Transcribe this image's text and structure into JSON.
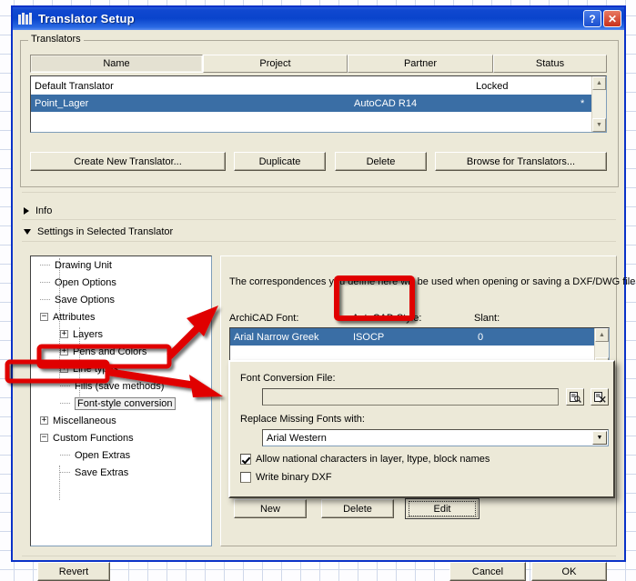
{
  "window": {
    "title": "Translator Setup",
    "icon": "archicad-bars-icon",
    "help_label": "?",
    "close_label": "✕"
  },
  "translators_group": {
    "label": "Translators",
    "columns": [
      "Name",
      "Project",
      "Partner",
      "Status"
    ],
    "rows": [
      {
        "name": "Default Translator",
        "project": "",
        "partner": "",
        "status": "Locked",
        "selected": false
      },
      {
        "name": "Point_Lager",
        "project": "AutoCAD R14",
        "partner": "",
        "status": "*",
        "selected": true
      }
    ],
    "buttons": [
      "Create New Translator...",
      "Duplicate",
      "Delete",
      "Browse for Translators..."
    ]
  },
  "sections": {
    "info": {
      "label": "Info",
      "expanded": false
    },
    "settings": {
      "label": "Settings in Selected Translator",
      "expanded": true
    }
  },
  "tree": {
    "items": [
      {
        "label": "Drawing Unit",
        "indent": 0,
        "toggle": "",
        "selected": false
      },
      {
        "label": "Open Options",
        "indent": 0,
        "toggle": "",
        "selected": false
      },
      {
        "label": "Save Options",
        "indent": 0,
        "toggle": "",
        "selected": false
      },
      {
        "label": "Attributes",
        "indent": 0,
        "toggle": "-",
        "selected": false
      },
      {
        "label": "Layers",
        "indent": 1,
        "toggle": "+",
        "selected": false
      },
      {
        "label": "Pens and Colors",
        "indent": 1,
        "toggle": "+",
        "selected": false
      },
      {
        "label": "Line types",
        "indent": 1,
        "toggle": "+",
        "selected": false
      },
      {
        "label": "Fills (save methods)",
        "indent": 1,
        "toggle": "",
        "selected": false
      },
      {
        "label": "Font-style conversion",
        "indent": 1,
        "toggle": "",
        "selected": true
      },
      {
        "label": "Miscellaneous",
        "indent": 0,
        "toggle": "+",
        "selected": false
      },
      {
        "label": "Custom Functions",
        "indent": 0,
        "toggle": "-",
        "selected": false
      },
      {
        "label": "Open Extras",
        "indent": 1,
        "toggle": "",
        "selected": false
      },
      {
        "label": "Save Extras",
        "indent": 1,
        "toggle": "",
        "selected": false
      }
    ]
  },
  "panel": {
    "description": "The correspondences you define here will be used when opening or saving a DXF/DWG file.",
    "columns": {
      "archicad_font": "ArchiCAD Font:",
      "autocad_style": "AutoCAD Style:",
      "slant": "Slant:"
    },
    "rows": [
      {
        "archicad_font": "Arial Narrow Greek",
        "autocad_style": "ISOCP",
        "slant": "0",
        "selected": true
      }
    ],
    "buttons": {
      "new": "New",
      "delete": "Delete",
      "edit": "Edit"
    }
  },
  "subdialog": {
    "font_conversion_file_label": "Font Conversion File:",
    "font_conversion_file_value": "",
    "browse_icon": "browse-file-icon",
    "clear_icon": "clear-file-icon",
    "replace_missing_label": "Replace Missing Fonts with:",
    "replace_missing_value": "Arial Western",
    "dropdown_icon": "chevron-down-icon",
    "checkboxes": [
      {
        "label": "Allow national characters in layer, ltype, block names",
        "checked": true
      },
      {
        "label": "Write binary DXF",
        "checked": false
      }
    ]
  },
  "footer": {
    "revert": "Revert",
    "cancel": "Cancel",
    "ok": "OK"
  },
  "annotations": {
    "highlights": [
      "Font-style conversion",
      "Miscellaneous",
      "AutoCAD Style:"
    ],
    "color": "#e00000"
  }
}
